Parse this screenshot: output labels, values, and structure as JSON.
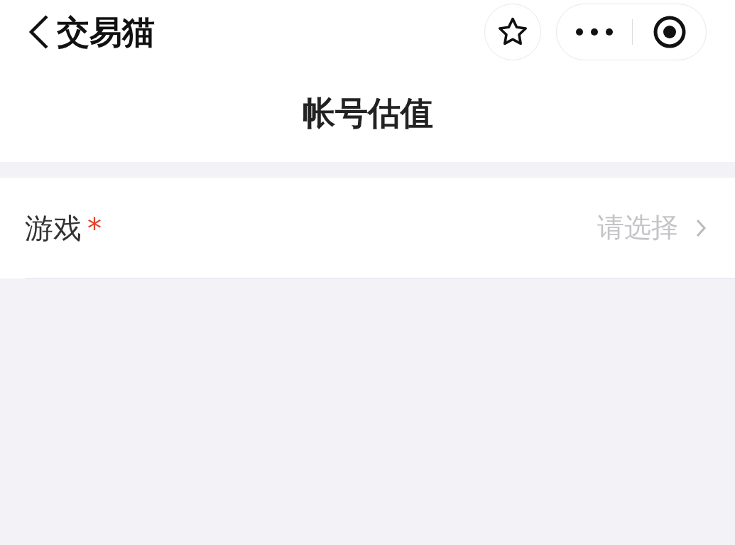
{
  "nav_bar": {
    "title": "交易猫"
  },
  "page_title": "帐号估值",
  "form": {
    "fields": [
      {
        "label": "游戏",
        "required": true,
        "required_mark": "*",
        "placeholder": "请选择"
      }
    ]
  }
}
